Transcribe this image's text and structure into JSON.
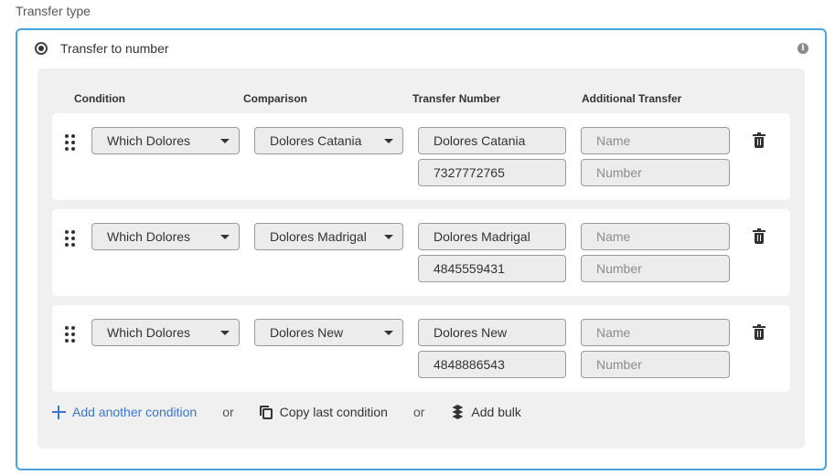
{
  "section_label": "Transfer type",
  "transfer_option": {
    "label": "Transfer to number",
    "selected": true
  },
  "info_icon": "info-icon",
  "columns": {
    "condition": "Condition",
    "comparison": "Comparison",
    "transfer_number": "Transfer Number",
    "additional_transfer": "Additional Transfer"
  },
  "rows": [
    {
      "condition": "Which Dolores",
      "comparison": "Dolores Catania",
      "transfer_name": "Dolores Catania",
      "transfer_number": "7327772765",
      "additional_name_placeholder": "Name",
      "additional_number_placeholder": "Number"
    },
    {
      "condition": "Which Dolores",
      "comparison": "Dolores Madrigal",
      "transfer_name": "Dolores Madrigal",
      "transfer_number": "4845559431",
      "additional_name_placeholder": "Name",
      "additional_number_placeholder": "Number"
    },
    {
      "condition": "Which Dolores",
      "comparison": "Dolores New",
      "transfer_name": "Dolores New",
      "transfer_number": "4848886543",
      "additional_name_placeholder": "Name",
      "additional_number_placeholder": "Number"
    }
  ],
  "actions": {
    "add_condition": "Add another condition",
    "or_1": "or",
    "copy_last": "Copy last condition",
    "or_2": "or",
    "add_bulk": "Add bulk"
  },
  "colors": {
    "accent_border": "#4aa3df",
    "link": "#3b78c7",
    "panel_bg": "#f0f0f0"
  }
}
